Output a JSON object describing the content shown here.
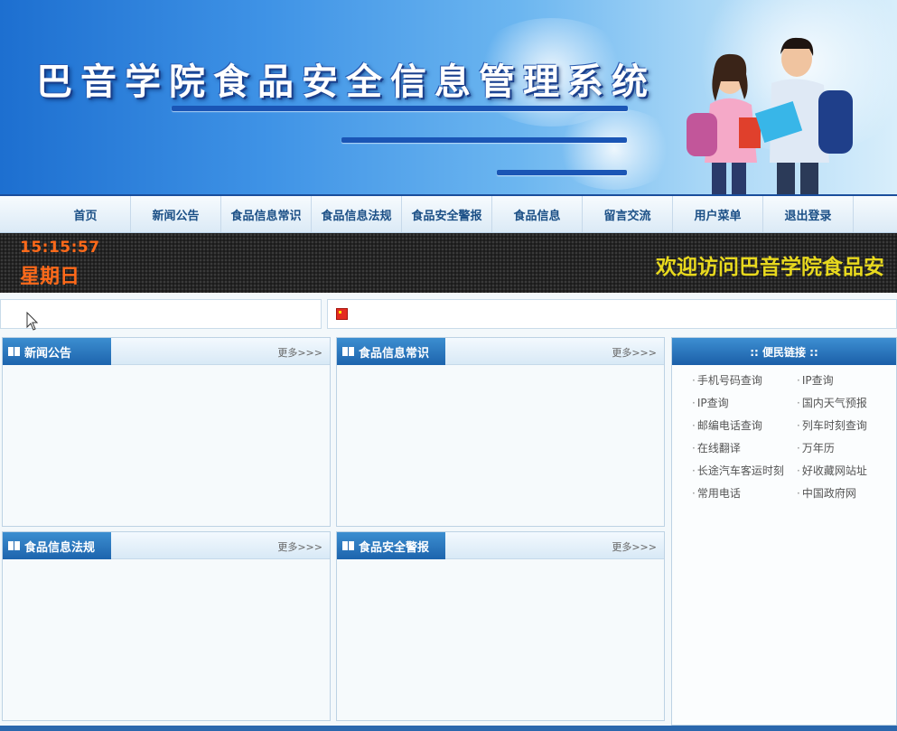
{
  "banner": {
    "title": "巴音学院食品安全信息管理系统"
  },
  "nav": {
    "items": [
      "首页",
      "新闻公告",
      "食品信息常识",
      "食品信息法规",
      "食品安全警报",
      "食品信息",
      "留言交流",
      "用户菜单",
      "退出登录"
    ]
  },
  "led": {
    "time": "15:15:57",
    "day": "星期日",
    "marquee": "欢迎访问巴音学院食品安"
  },
  "panels": [
    {
      "title": "新闻公告",
      "more": "更多>>>"
    },
    {
      "title": "食品信息常识",
      "more": "更多>>>"
    },
    {
      "title": "食品信息法规",
      "more": "更多>>>"
    },
    {
      "title": "食品安全警报",
      "more": "更多>>>"
    }
  ],
  "side": {
    "title": ":: 便民链接 ::",
    "links": [
      "手机号码查询",
      "IP查询",
      "IP查询",
      "国内天气预报",
      "邮编电话查询",
      "列车时刻查询",
      "在线翻译",
      "万年历",
      "长途汽车客运时刻",
      "好收藏网站址",
      "常用电话",
      "中国政府网"
    ]
  }
}
